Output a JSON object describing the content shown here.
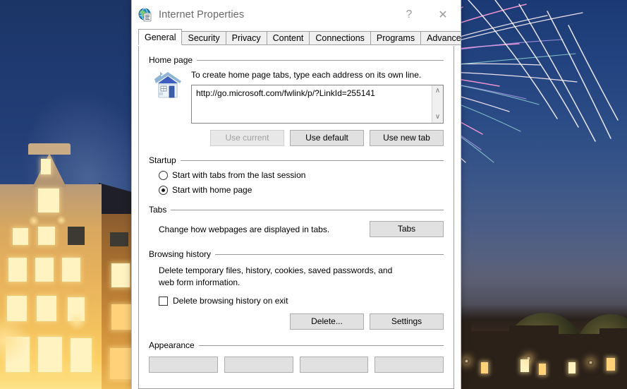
{
  "window": {
    "title": "Internet Properties",
    "icon": "internet-properties-icon",
    "help_label": "?",
    "close_label": "✕"
  },
  "tabs": [
    {
      "label": "General",
      "active": true
    },
    {
      "label": "Security",
      "active": false
    },
    {
      "label": "Privacy",
      "active": false
    },
    {
      "label": "Content",
      "active": false
    },
    {
      "label": "Connections",
      "active": false
    },
    {
      "label": "Programs",
      "active": false
    },
    {
      "label": "Advanced",
      "active": false
    }
  ],
  "home_page": {
    "group_label": "Home page",
    "note": "To create home page tabs, type each address on its own line.",
    "address_value": "http://go.microsoft.com/fwlink/p/?LinkId=255141",
    "scroll_up": "∧",
    "scroll_down": "∨",
    "buttons": [
      {
        "label": "Use current",
        "disabled": true
      },
      {
        "label": "Use default",
        "disabled": false
      },
      {
        "label": "Use new tab",
        "disabled": false
      }
    ]
  },
  "startup": {
    "group_label": "Startup",
    "options": [
      {
        "label": "Start with tabs from the last session",
        "checked": false
      },
      {
        "label": "Start with home page",
        "checked": true
      }
    ]
  },
  "tabs_section": {
    "group_label": "Tabs",
    "description": "Change how webpages are displayed in tabs.",
    "button_label": "Tabs"
  },
  "browsing_history": {
    "group_label": "Browsing history",
    "description": "Delete temporary files, history, cookies, saved passwords, and web form information.",
    "checkbox_label": "Delete browsing history on exit",
    "checkbox_checked": false,
    "buttons": [
      {
        "label": "Delete..."
      },
      {
        "label": "Settings"
      }
    ]
  },
  "appearance": {
    "group_label": "Appearance",
    "buttons": [
      {
        "label": ""
      },
      {
        "label": ""
      },
      {
        "label": ""
      },
      {
        "label": ""
      }
    ]
  },
  "colors": {
    "accent": "#0078d7",
    "dialog_bg": "#ffffff",
    "button_face": "#e1e1e1",
    "button_border": "#adadad",
    "group_rule": "#9a9a9a",
    "title_text": "#6a6a6a",
    "disabled_text": "#a0a0a0"
  }
}
